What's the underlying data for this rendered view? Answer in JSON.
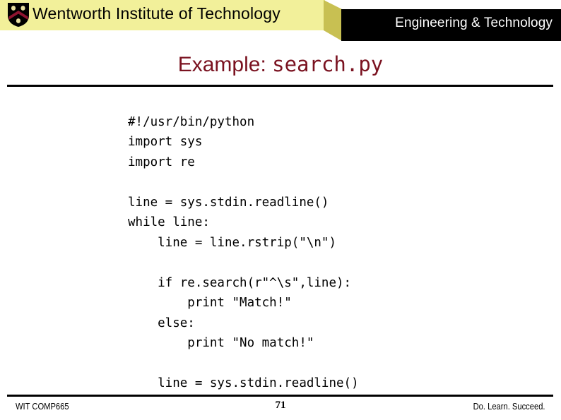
{
  "header": {
    "logo_alt": "wentworth-shield-crest",
    "organization": "Wentworth Institute of Technology",
    "department": "Engineering & Technology",
    "colors": {
      "banner_yellow": "#f2f09a",
      "banner_yellow_dark": "#c8c052",
      "banner_black": "#000000",
      "shield_field": "#000000",
      "shield_chevron": "#8e1430",
      "shield_charge": "#e8e0a0"
    }
  },
  "title": {
    "prefix": "Example: ",
    "filename": "search.py",
    "color": "#7a1220"
  },
  "code": {
    "language": "python",
    "lines": [
      "#!/usr/bin/python",
      "import sys",
      "import re",
      "",
      "line = sys.stdin.readline()",
      "while line:",
      "    line = line.rstrip(\"\\n\")",
      "",
      "    if re.search(r\"^\\s\",line):",
      "        print \"Match!\"",
      "    else:",
      "        print \"No match!\"",
      "",
      "    line = sys.stdin.readline()"
    ]
  },
  "footer": {
    "course": "WIT COMP665",
    "page_number": "71",
    "tagline": "Do. Learn. Succeed."
  }
}
